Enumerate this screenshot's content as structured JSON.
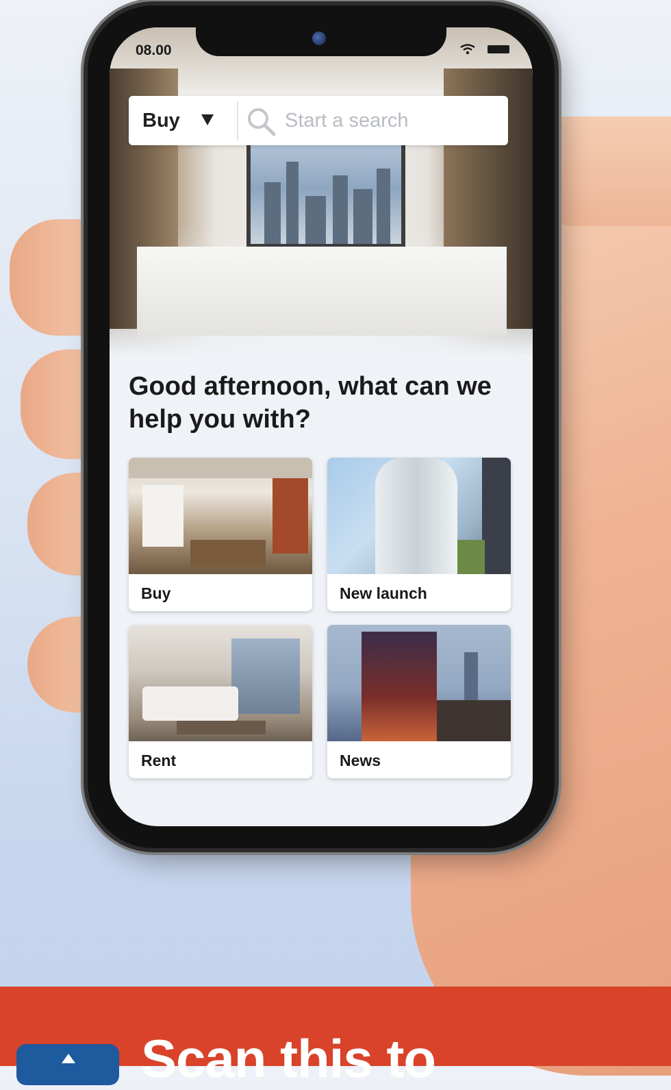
{
  "status_bar": {
    "time": "08.00"
  },
  "search": {
    "mode": "Buy",
    "placeholder": "Start a search"
  },
  "greeting": "Good afternoon, what can we help you with?",
  "cards": [
    {
      "label": "Buy"
    },
    {
      "label": "New launch"
    },
    {
      "label": "Rent"
    },
    {
      "label": "News"
    }
  ],
  "banner": {
    "text": "Scan this to"
  },
  "colors": {
    "banner": "#d8432a",
    "accent_icon": "#1e5a9e"
  }
}
